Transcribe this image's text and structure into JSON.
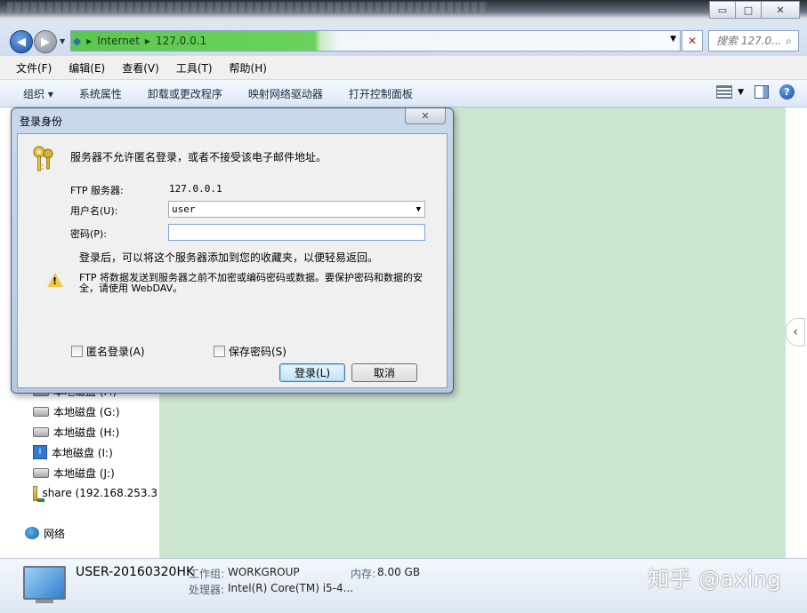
{
  "window": {
    "minimize_glyph": "▭",
    "maximize_glyph": "□",
    "close_glyph": "✕"
  },
  "address": {
    "crumbs": [
      "Internet",
      "127.0.0.1"
    ],
    "search_placeholder": "搜索 127.0...",
    "bar_color": "#5ac74d"
  },
  "menu": [
    "文件(F)",
    "编辑(E)",
    "查看(V)",
    "工具(T)",
    "帮助(H)"
  ],
  "commands": [
    "组织 ▾",
    "系统属性",
    "卸载或更改程序",
    "映射网络驱动器",
    "打开控制面板"
  ],
  "nav": {
    "items": [
      {
        "label": "本地磁盘 (F:)",
        "icon": "drive-icon"
      },
      {
        "label": "本地磁盘 (G:)",
        "icon": "drive-icon"
      },
      {
        "label": "本地磁盘 (H:)",
        "icon": "drive-icon"
      },
      {
        "label": "本地磁盘 (I:)",
        "icon": "drive-i-icon"
      },
      {
        "label": "本地磁盘 (J:)",
        "icon": "drive-icon"
      },
      {
        "label": "share (192.168.253.3",
        "icon": "share-icon"
      }
    ],
    "network_label": "网络"
  },
  "status": {
    "computer_name": "USER-20160320HK",
    "workgroup_label": "工作组:",
    "workgroup_value": "WORKGROUP",
    "memory_label": "内存:",
    "memory_value": "8.00 GB",
    "cpu_label": "处理器:",
    "cpu_value": "Intel(R) Core(TM) i5-4..."
  },
  "watermark": "知乎 @axing",
  "dialog": {
    "title": "登录身份",
    "message": "服务器不允许匿名登录，或者不接受该电子邮件地址。",
    "ftp_server_label": "FTP 服务器:",
    "ftp_server_value": "127.0.0.1",
    "username_label": "用户名(U):",
    "username_value": "user",
    "password_label": "密码(P):",
    "password_value": "",
    "note": "登录后，可以将这个服务器添加到您的收藏夹，以便轻易返回。",
    "warning": "FTP 将数据发送到服务器之前不加密或编码密码或数据。要保护密码和数据的安全，请使用 WebDAV。",
    "anonymous_label": "匿名登录(A)",
    "save_password_label": "保存密码(S)",
    "login_button": "登录(L)",
    "cancel_button": "取消",
    "close_glyph": "✕"
  },
  "colors": {
    "content_bg": "#cce6cf",
    "dialog_frame": "#c9d9ec"
  }
}
